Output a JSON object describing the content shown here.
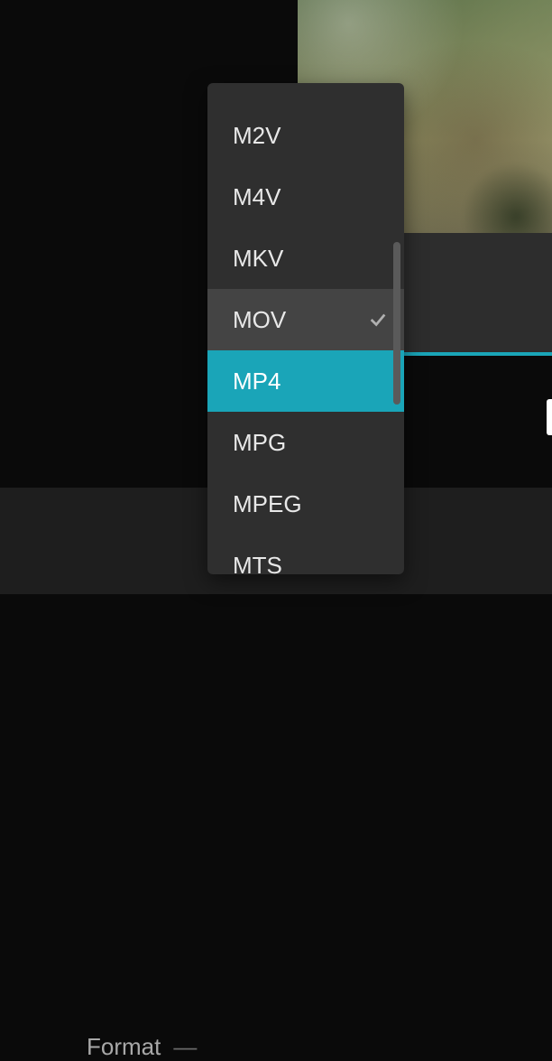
{
  "bottom_panel": {
    "format_label": "Format",
    "format_separator": "—"
  },
  "format_dropdown": {
    "items": [
      {
        "label": "M2V",
        "state": "normal"
      },
      {
        "label": "M4V",
        "state": "normal"
      },
      {
        "label": "MKV",
        "state": "normal"
      },
      {
        "label": "MOV",
        "state": "hovered_checked"
      },
      {
        "label": "MP4",
        "state": "selected"
      },
      {
        "label": "MPG",
        "state": "normal"
      },
      {
        "label": "MPEG",
        "state": "normal"
      },
      {
        "label": "MTS",
        "state": "normal"
      }
    ]
  },
  "accent_color": "#1aa5b8"
}
